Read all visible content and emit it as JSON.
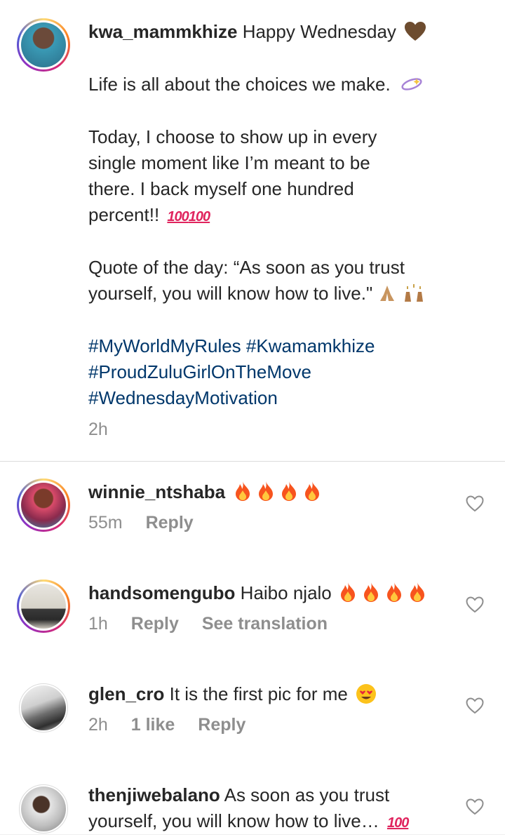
{
  "caption": {
    "username": "kwa_mammkhize",
    "lines": [
      "Happy Wednesday",
      "Life is all about the choices we make.",
      "Today, I choose to show up in every",
      "single moment like I’m meant to be",
      "there. I back myself one hundred",
      "percent!!",
      "Quote of the day: “As soon as you trust",
      "yourself, you will know how to live.\""
    ],
    "hashtags": [
      "#MyWorldMyRules",
      "#Kwamamkhize",
      "#ProudZuluGirlOnTheMove",
      "#WednesdayMotivation"
    ],
    "time": "2h"
  },
  "comments": [
    {
      "username": "winnie_ntshaba",
      "text": "",
      "time": "55m",
      "actions": [
        "Reply"
      ]
    },
    {
      "username": "handsomengubo",
      "text": "Haibo njalo",
      "time": "1h",
      "actions": [
        "Reply",
        "See translation"
      ]
    },
    {
      "username": "glen_cro",
      "text": "It is the first pic for me",
      "time": "2h",
      "likes": "1 like",
      "actions": [
        "Reply"
      ]
    },
    {
      "username": "thenjiwebalano",
      "text": "As soon as you trust",
      "text2": "yourself, you will know how to live…"
    }
  ],
  "icons": {
    "heart": "heart-outline-icon",
    "brown_heart": "brown-heart-emoji",
    "fire": "fire-emoji",
    "hundred": "hundred-points-emoji",
    "sparkles": "dizzy-emoji",
    "pray": "folded-hands-emoji",
    "raise": "raising-hands-emoji",
    "heart_eyes": "heart-eyes-emoji"
  },
  "colors": {
    "link": "#00376b",
    "secondary": "#8e8e8e",
    "divider": "#dbdbdb"
  }
}
